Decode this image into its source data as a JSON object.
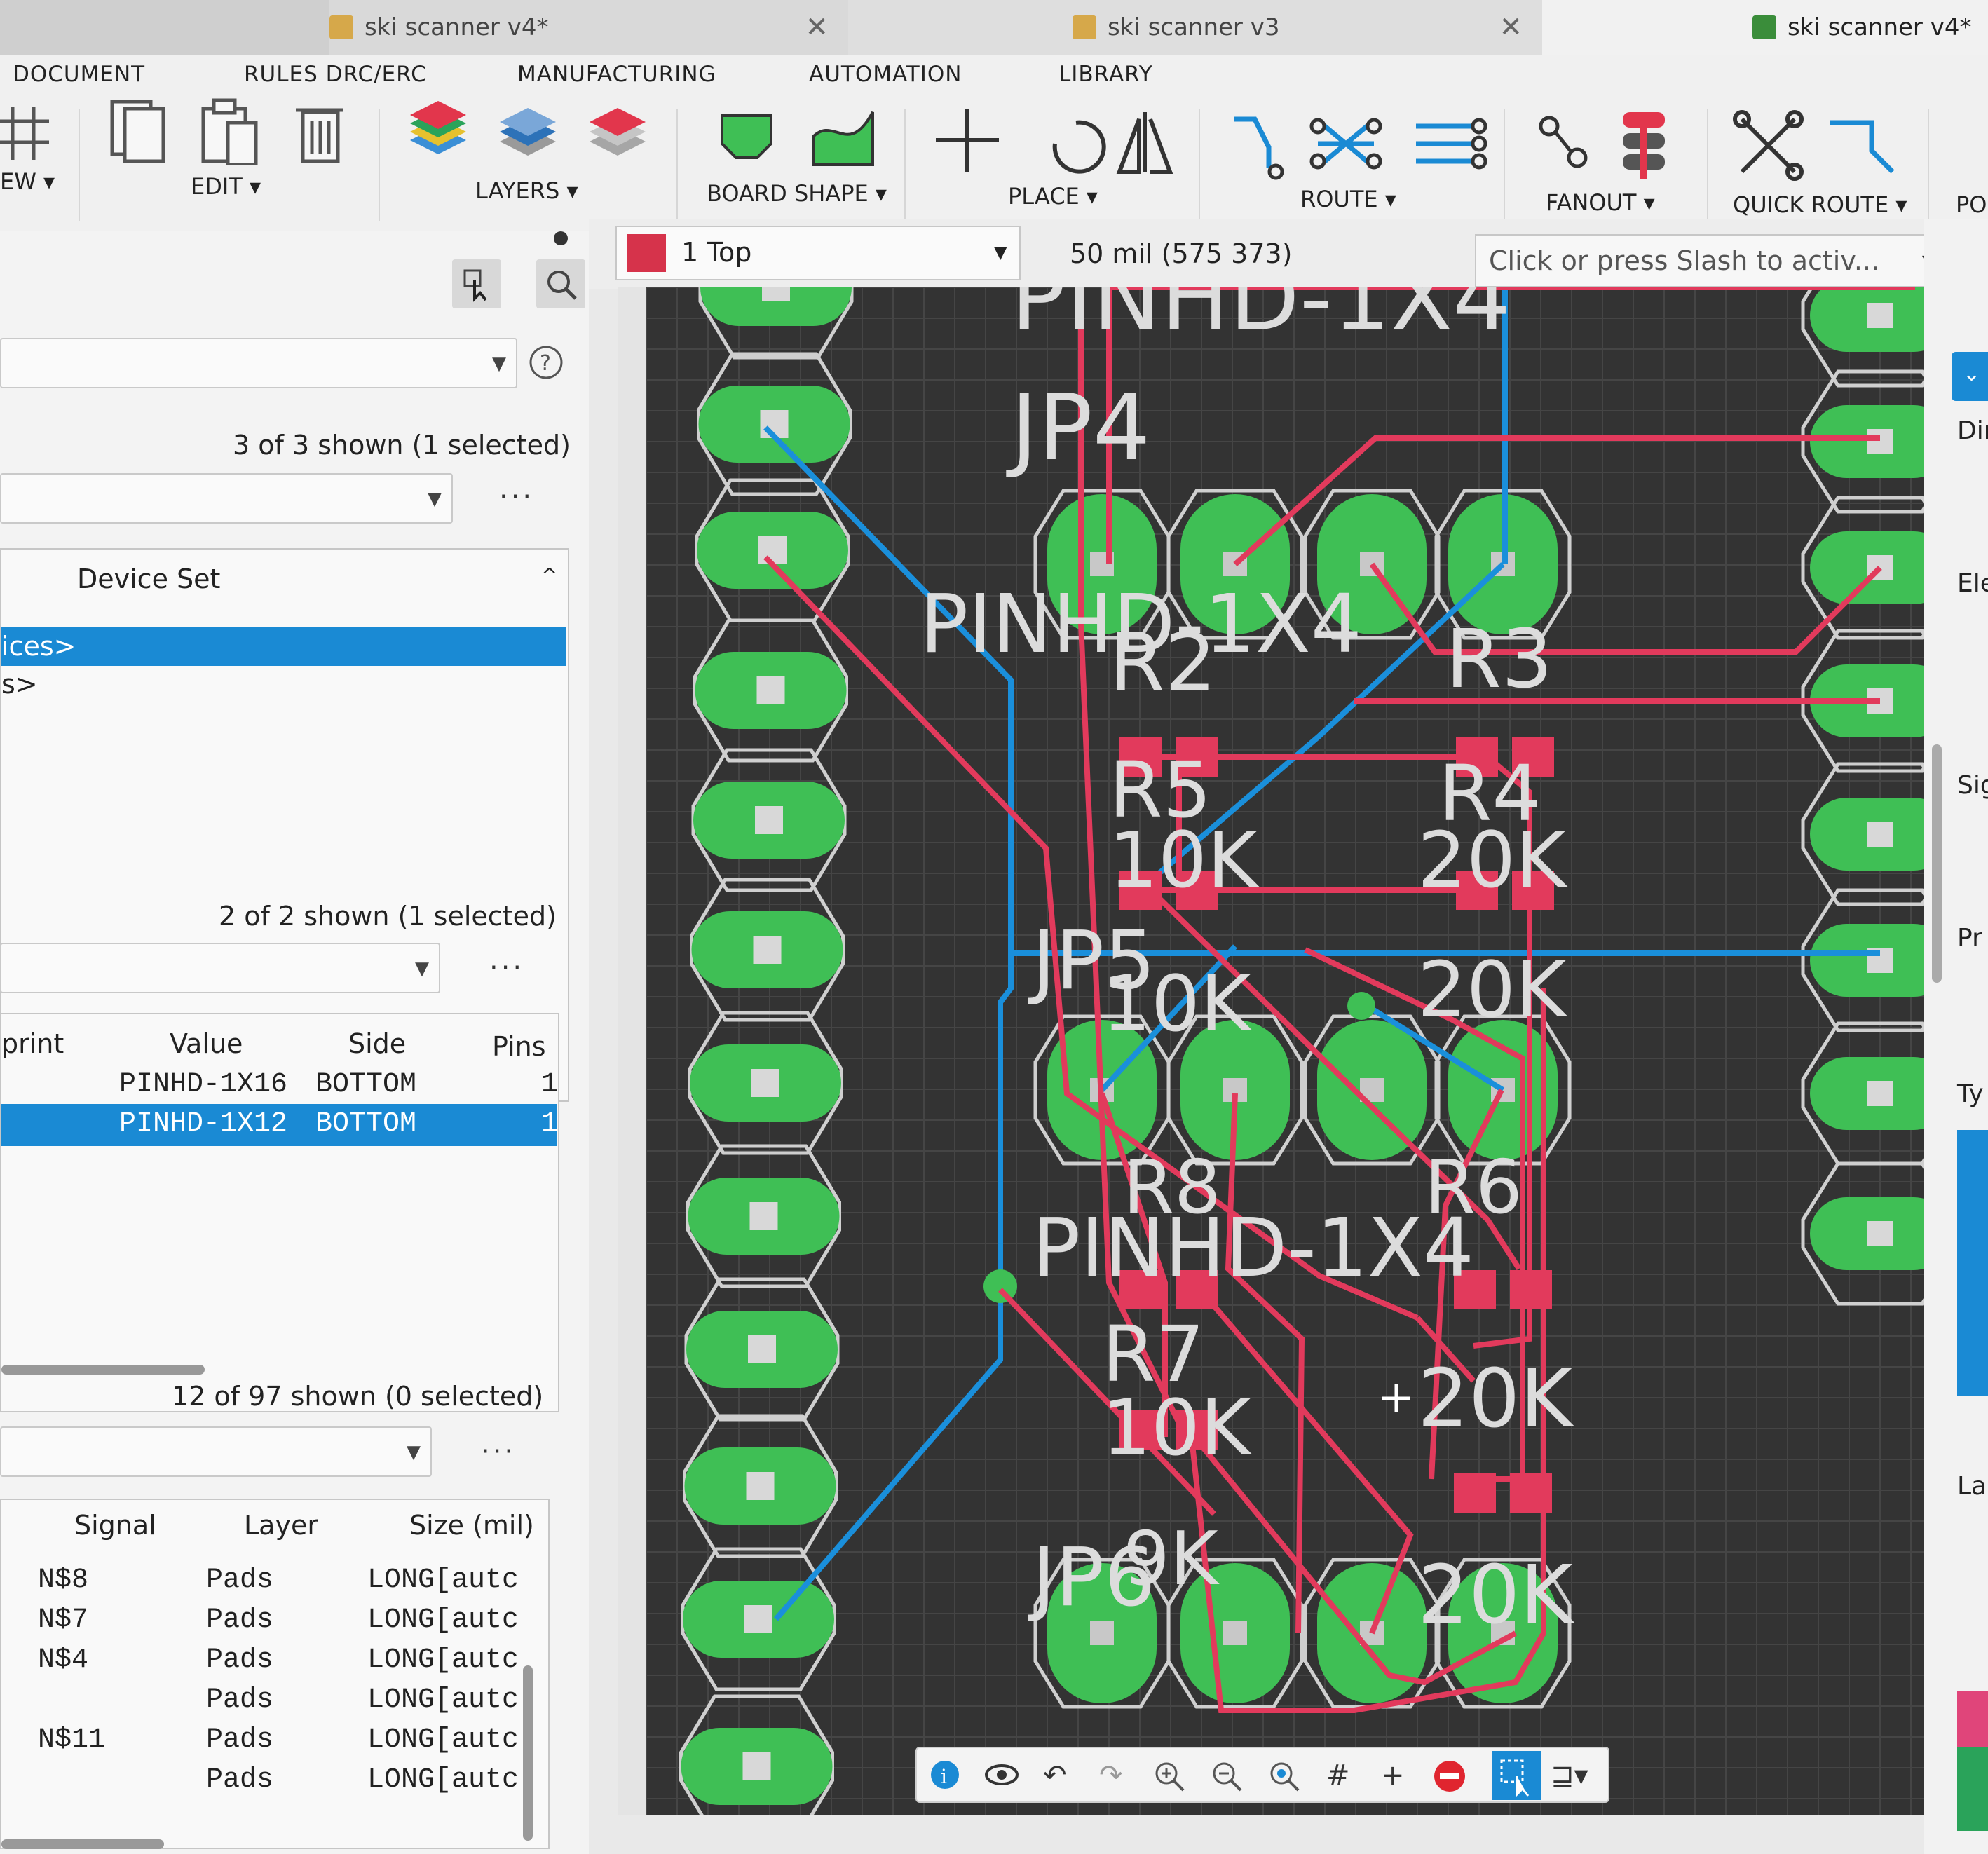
{
  "tabs": [
    {
      "label": "ski scanner v4*"
    },
    {
      "label": "ski scanner v3"
    },
    {
      "label": "ski scanner v4*"
    }
  ],
  "menu": [
    "DOCUMENT",
    "RULES DRC/ERC",
    "MANUFACTURING",
    "AUTOMATION",
    "LIBRARY"
  ],
  "ribbon": {
    "view": "EW",
    "edit": "EDIT",
    "layers": "LAYERS",
    "board_shape": "BOARD SHAPE",
    "place": "PLACE",
    "route": "ROUTE",
    "fanout": "FANOUT",
    "quick_route": "QUICK ROUTE",
    "po": "PO"
  },
  "command_bar": {
    "layer": "1 Top",
    "layer_color": "#d6334b",
    "grid_status": "50 mil (575 373)",
    "command_placeholder": "Click or press Slash to activ..."
  },
  "left_panel": {
    "count1": "3 of 3 shown (1 selected)",
    "device_set_header": "Device Set",
    "device_list": [
      "ices>",
      "s>"
    ],
    "count2": "2 of 2 shown (1 selected)",
    "parts_headers": [
      "print",
      "Value",
      "Side",
      "Pins"
    ],
    "parts_rows": [
      {
        "value": "PINHD-1X16",
        "side": "BOTTOM",
        "pins": "1"
      },
      {
        "value": "PINHD-1X12",
        "side": "BOTTOM",
        "pins": "1"
      }
    ],
    "count3": "12 of 97 shown (0 selected)",
    "signal_headers": [
      "Signal",
      "Layer",
      "Size (mil)"
    ],
    "signal_rows": [
      {
        "signal": "N$8",
        "layer": "Pads",
        "size": "LONG[autc"
      },
      {
        "signal": "N$7",
        "layer": "Pads",
        "size": "LONG[autc"
      },
      {
        "signal": "N$4",
        "layer": "Pads",
        "size": "LONG[autc"
      },
      {
        "signal": "",
        "layer": "Pads",
        "size": "LONG[autc"
      },
      {
        "signal": "N$11",
        "layer": "Pads",
        "size": "LONG[autc"
      },
      {
        "signal": "",
        "layer": "Pads",
        "size": "LONG[autc"
      }
    ]
  },
  "canvas_labels": {
    "top_value": "PINHD-1X4",
    "jp4": "JP4",
    "value_mid1": "PINHD-1X4",
    "r2": "R2",
    "r3": "R3",
    "r5": "R5",
    "r5_val": "10K",
    "r4": "R4",
    "r4_val": "20K",
    "jp5": "JP5",
    "r5b_val": "10K",
    "r6_val": "20K",
    "r8": "R8",
    "r6": "R6",
    "value_mid2": "PINHD-1X4",
    "r7": "R7",
    "r7_val": "10K",
    "r9_val": "20K",
    "jp6": "JP6",
    "r9b_val": "9K",
    "r9c_val": "20K"
  },
  "right_panel": [
    "Dir",
    "Ele",
    "Sig",
    "Pr",
    "Ty",
    "La"
  ],
  "colors": {
    "board_bg": "#333333",
    "pad_green": "#3fbf55",
    "trace_red": "#e23a5c",
    "trace_blue": "#1a8fdb",
    "selection_blue": "#1a8ad4"
  }
}
